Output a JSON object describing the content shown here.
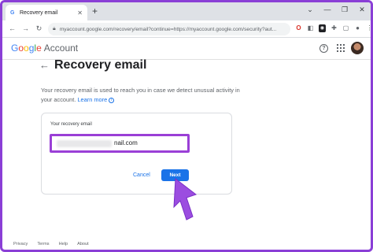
{
  "browser": {
    "tab_title": "Recovery email",
    "tab_favicon": "G",
    "url": "myaccount.google.com/recovery/email?continue=https://myaccount.google.com/security?aut..."
  },
  "header": {
    "logo_letters": [
      "G",
      "o",
      "o",
      "g",
      "l",
      "e"
    ],
    "logo_suffix": "Account"
  },
  "page": {
    "title": "Recovery email",
    "description": "Your recovery email is used to reach you in case we detect unusual activity in your account.",
    "learn_more": "Learn more"
  },
  "card": {
    "label": "Your recovery email",
    "email_visible_suffix": "nail.com",
    "cancel_label": "Cancel",
    "next_label": "Next"
  },
  "footer": {
    "links": [
      "Privacy",
      "Terms",
      "Help",
      "About"
    ]
  },
  "colors": {
    "accent": "#1a73e8",
    "highlight": "#9a3fd6"
  }
}
